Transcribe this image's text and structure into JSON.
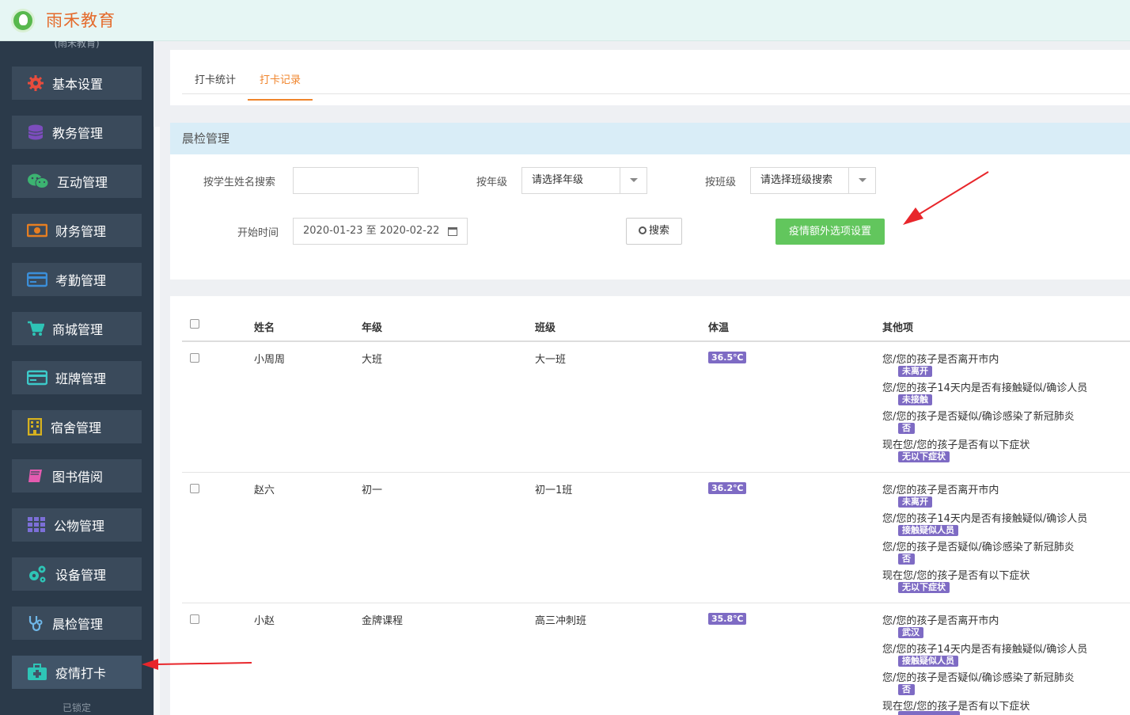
{
  "app": {
    "logo_text": "雨禾教育",
    "sub_text": "(雨禾教育)"
  },
  "sidebar": {
    "items": [
      {
        "label": "基本设置",
        "icon": "gear-icon",
        "color": "#e84c3d"
      },
      {
        "label": "教务管理",
        "icon": "database-icon",
        "color": "#7c4dbd"
      },
      {
        "label": "互动管理",
        "icon": "wechat-icon",
        "color": "#3cb371"
      },
      {
        "label": "财务管理",
        "icon": "money-icon",
        "color": "#e67e22"
      },
      {
        "label": "考勤管理",
        "icon": "card-icon",
        "color": "#3b8ed8"
      },
      {
        "label": "商城管理",
        "icon": "cart-icon",
        "color": "#2ec4b6"
      },
      {
        "label": "班牌管理",
        "icon": "id-card-icon",
        "color": "#3dc9c9"
      },
      {
        "label": "宿舍管理",
        "icon": "building-icon",
        "color": "#d6b11f"
      },
      {
        "label": "图书借阅",
        "icon": "book-icon",
        "color": "#e45bb0"
      },
      {
        "label": "公物管理",
        "icon": "grid-icon",
        "color": "#7c6fd8"
      },
      {
        "label": "设备管理",
        "icon": "cogs-icon",
        "color": "#2ec4b6"
      },
      {
        "label": "晨检管理",
        "icon": "stethoscope-icon",
        "color": "#6fb7e8"
      },
      {
        "label": "疫情打卡",
        "icon": "medkit-icon",
        "color": "#2ec4b6"
      }
    ],
    "footer": "已锁定"
  },
  "tabs": [
    {
      "label": "打卡统计",
      "active": false
    },
    {
      "label": "打卡记录",
      "active": true
    }
  ],
  "filter": {
    "title": "晨检管理",
    "name_label": "按学生姓名搜索",
    "name_value": "",
    "grade_label": "按年级",
    "grade_value": "请选择年级",
    "class_label": "按班级",
    "class_value": "请选择班级搜索",
    "time_label": "开始时间",
    "time_value": "2020-01-23 至 2020-02-22",
    "search_button": "搜索",
    "extra_button": "疫情额外选项设置"
  },
  "table": {
    "headers": [
      "姓名",
      "年级",
      "班级",
      "体温",
      "其他项"
    ],
    "rows": [
      {
        "name": "小周周",
        "grade": "大班",
        "class": "大一班",
        "temp": "36.5℃",
        "items": [
          {
            "q": "您/您的孩子是否离开市内",
            "a": "未离开"
          },
          {
            "q": "您/您的孩子14天内是否有接触疑似/确诊人员",
            "a": "未接触"
          },
          {
            "q": "您/您的孩子是否疑似/确诊感染了新冠肺炎",
            "a": "否"
          },
          {
            "q": "现在您/您的孩子是否有以下症状",
            "a": "无以下症状"
          }
        ]
      },
      {
        "name": "赵六",
        "grade": "初一",
        "class": "初一1班",
        "temp": "36.2℃",
        "items": [
          {
            "q": "您/您的孩子是否离开市内",
            "a": "未离开"
          },
          {
            "q": "您/您的孩子14天内是否有接触疑似/确诊人员",
            "a": "接触疑似人员"
          },
          {
            "q": "您/您的孩子是否疑似/确诊感染了新冠肺炎",
            "a": "否"
          },
          {
            "q": "现在您/您的孩子是否有以下症状",
            "a": "无以下症状"
          }
        ]
      },
      {
        "name": "小赵",
        "grade": "金牌课程",
        "class": "高三冲刺班",
        "temp": "35.8℃",
        "items": [
          {
            "q": "您/您的孩子是否离开市内",
            "a": "武汉"
          },
          {
            "q": "您/您的孩子14天内是否有接触疑似/确诊人员",
            "a": "接触疑似人员"
          },
          {
            "q": "您/您的孩子是否疑似/确诊感染了新冠肺炎",
            "a": "否"
          },
          {
            "q": "现在您/您的孩子是否有以下症状",
            "a": ""
          }
        ]
      }
    ]
  }
}
